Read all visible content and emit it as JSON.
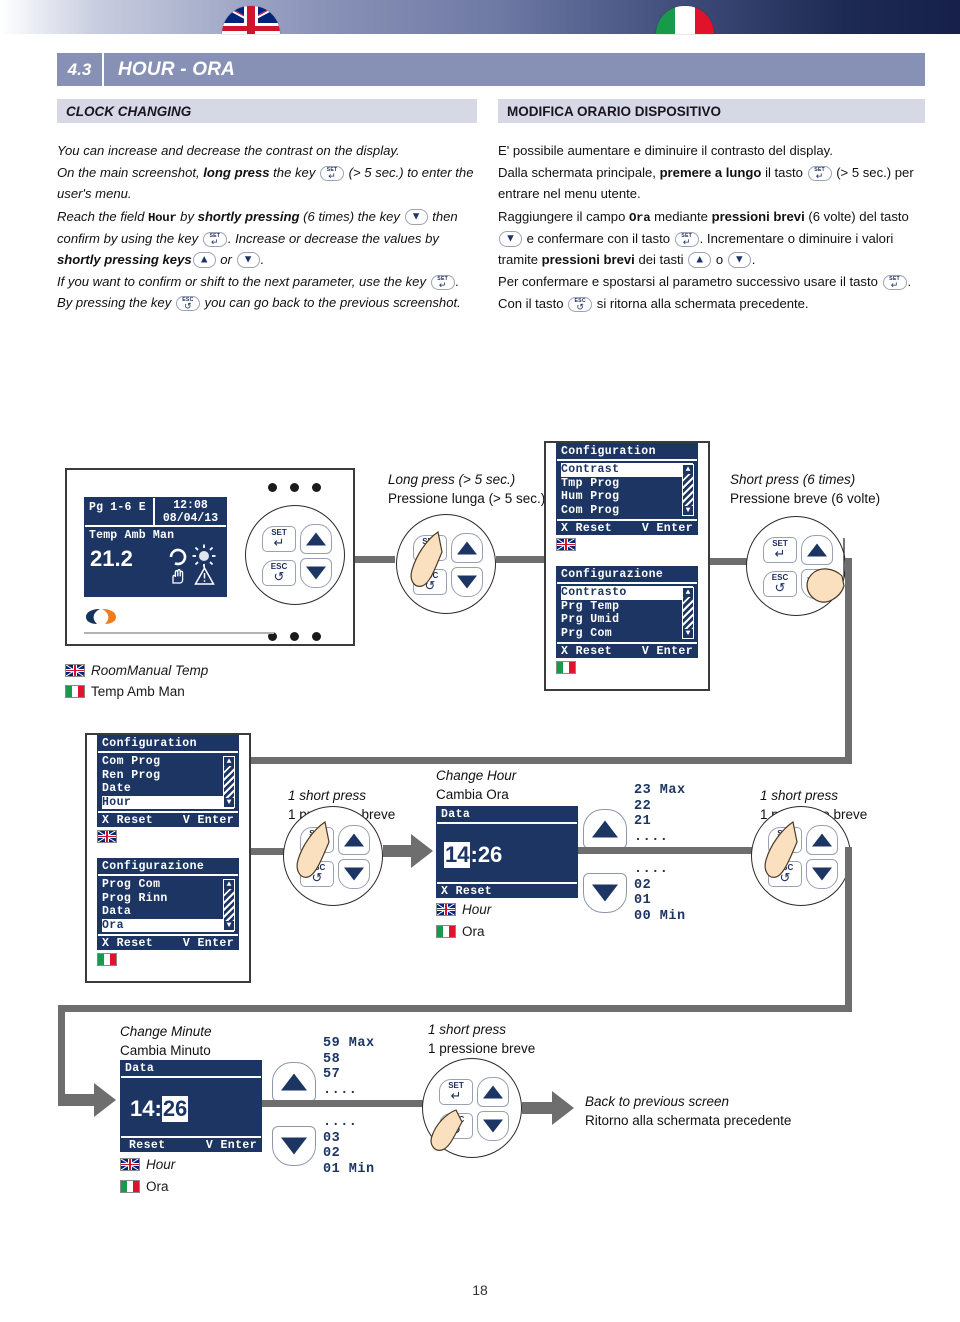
{
  "header": {
    "section_number": "4.3",
    "title_en": "HOUR",
    "title_sep": "-",
    "title_it": "ORA",
    "flags": [
      "uk-flag-tab",
      "italy-flag-tab"
    ]
  },
  "subheaders": {
    "en": "CLOCK CHANGING",
    "it": "MODIFICA ORARIO DISPOSITIVO"
  },
  "body_en": {
    "p1": "You can increase and decrease the contrast on the display.",
    "p2a": "On the main screenshot, ",
    "p2b": "long press",
    "p2c": " the key ",
    "p2d": " (> 5 sec.) to enter the user's menu.",
    "p3a": "Reach the field ",
    "p3_field": "Hour",
    "p3b": " by ",
    "p3c": "shortly pressing",
    "p3d": " (6 times) the key ",
    "p3e": " then confirm by using the key ",
    "p3f": ". Increase or decrease the values by ",
    "p3g": "shortly pressing keys",
    "p3h": " or ",
    "p3i": ".",
    "p4a": "If you want to confirm or shift to the next parameter, use the key ",
    "p4b": ". By pressing the key ",
    "p4c": " you can go back to the previous screenshot."
  },
  "body_it": {
    "p1": "E' possibile aumentare e  diminuire il contrasto del display.",
    "p2a": "Dalla schermata principale, ",
    "p2b": "premere a lungo",
    "p2c": " il tasto ",
    "p2d": " (> 5 sec.) per entrare nel menu utente.",
    "p3a": "Raggiungere il campo ",
    "p3_field": "Ora",
    "p3b": " mediante ",
    "p3c": "pressioni brevi",
    "p3d": " (6 volte) del tasto ",
    "p3e": " e confermare con il tasto ",
    "p3f": ". Incrementare o diminuire i valori tramite ",
    "p3g": "pressioni brevi",
    "p3h": " dei tasti ",
    "p3i": " o ",
    "p3j": ".",
    "p4a": "Per confermare e spostarsi al parametro successivo usare il tasto ",
    "p4b": ".",
    "p5a": "Con il tasto ",
    "p5b": " si ritorna alla schermata precedente."
  },
  "keys": {
    "set_label": "SET",
    "set_glyph": "↵",
    "esc_label": "ESC",
    "esc_glyph": "↺",
    "up_name": "chevron-up-icon",
    "down_name": "chevron-down-icon"
  },
  "main_screen": {
    "line1_left": "Pg 1-6 E",
    "line1_right_a": "12:08",
    "line1_right_b": "08/04/13",
    "line2": "Temp Amb Man",
    "value": "21.2",
    "label_en": "RoomManual Temp",
    "label_it": "Temp Amb Man"
  },
  "captions": {
    "long_press_en": "Long press (> 5 sec.)",
    "long_press_it": "Pressione lunga (> 5 sec.)",
    "short6_en": "Short press (6 times)",
    "short6_it": "Pressione breve (6 volte)",
    "short1_en": "1 short press",
    "short1_it": "1 pressione breve",
    "back_en": "Back to previous screen",
    "back_it": "Ritorno alla schermata precedente"
  },
  "menu_config_contrast_en": {
    "title": "Configuration",
    "items": [
      "Contrast",
      "Tmp Prog",
      "Hum Prog",
      "Com Prog"
    ],
    "selected": 0,
    "foot_left": "X Reset",
    "foot_right": "V Enter",
    "flag": "uk"
  },
  "menu_config_contrast_it": {
    "title": "Configurazione",
    "items": [
      "Contrasto",
      "Prg Temp",
      "Prg Umid",
      "Prg Com"
    ],
    "selected": 0,
    "foot_left": "X Reset",
    "foot_right": "V Enter",
    "flag": "it"
  },
  "menu_config_hour_en": {
    "title": "Configuration",
    "items": [
      "Com Prog",
      "Ren Prog",
      "Date",
      "Hour"
    ],
    "selected": 3,
    "foot_left": "X Reset",
    "foot_right": "V Enter",
    "flag": "uk"
  },
  "menu_config_hour_it": {
    "title": "Configurazione",
    "items": [
      "Prog Com",
      "Prog Rinn",
      "Data",
      "Ora"
    ],
    "selected": 3,
    "foot_left": "X Reset",
    "foot_right": "V Enter",
    "flag": "it"
  },
  "change_hour": {
    "caption_en": "Change Hour",
    "caption_it": "Cambia Ora",
    "screen_title": "Data",
    "time_hh": "14",
    "time_sep": ":",
    "time_mm": "26",
    "foot_left": "X Reset",
    "label_en": "Hour",
    "label_it": "Ora",
    "values_top": "23 Max\n22\n21\n....",
    "values_bottom": "....\n02\n01\n00 Min"
  },
  "change_minute": {
    "caption_en": "Change Minute",
    "caption_it": "Cambia Minuto",
    "screen_title": "Data",
    "time_hh": "14",
    "time_sep": ":",
    "time_mm": "26",
    "foot_left": "Reset",
    "foot_right": "V Enter",
    "label_en": "Hour",
    "label_it": "Ora",
    "values_top": "59 Max\n58\n57\n....",
    "values_bottom": "....\n03\n02\n01 Min"
  },
  "page_number": "18",
  "colors": {
    "header_band": "#8791b6",
    "subheader_band": "#d6d8e5",
    "lcd_bg": "#1c3563",
    "connector": "#6e6e6e",
    "accent_navy": "#1c3563"
  }
}
